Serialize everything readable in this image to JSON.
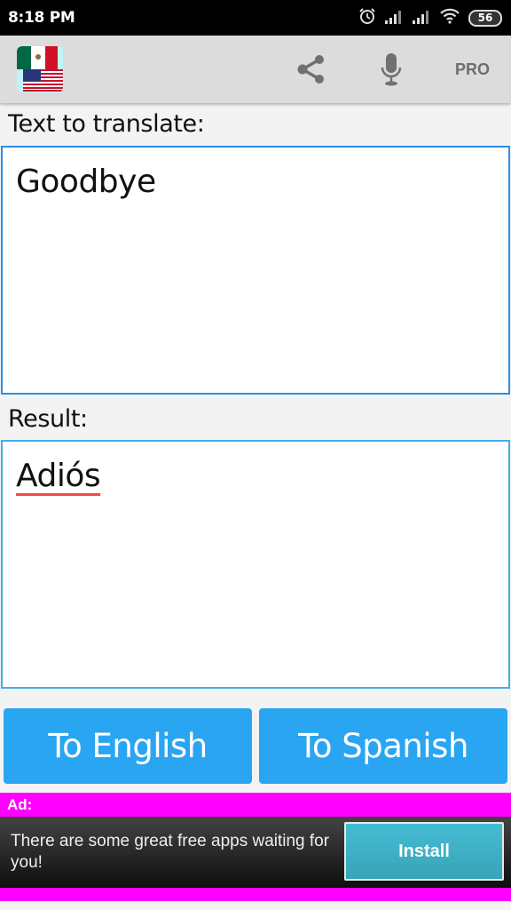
{
  "status_bar": {
    "time": "8:18 PM",
    "battery_level": "56",
    "icons": [
      "alarm-icon",
      "signal-icon",
      "signal-icon",
      "wifi-icon",
      "battery-icon"
    ]
  },
  "toolbar": {
    "logo": "mexico-usa-flags-logo",
    "share_icon": "share-icon",
    "mic_icon": "microphone-icon",
    "pro_label": "PRO"
  },
  "input": {
    "label": "Text to translate:",
    "value": "Goodbye"
  },
  "result": {
    "label": "Result:",
    "value": "Adiós"
  },
  "actions": {
    "to_english": "To English",
    "to_spanish": "To Spanish"
  },
  "ad": {
    "label": "Ad:",
    "text": "There are some great free apps waiting for you!",
    "install_label": "Install"
  },
  "colors": {
    "accent": "#2aa5f2",
    "field_border": "#2a8ee6",
    "ad_background": "#ff00ff",
    "spell_underline": "#f24a4a"
  }
}
